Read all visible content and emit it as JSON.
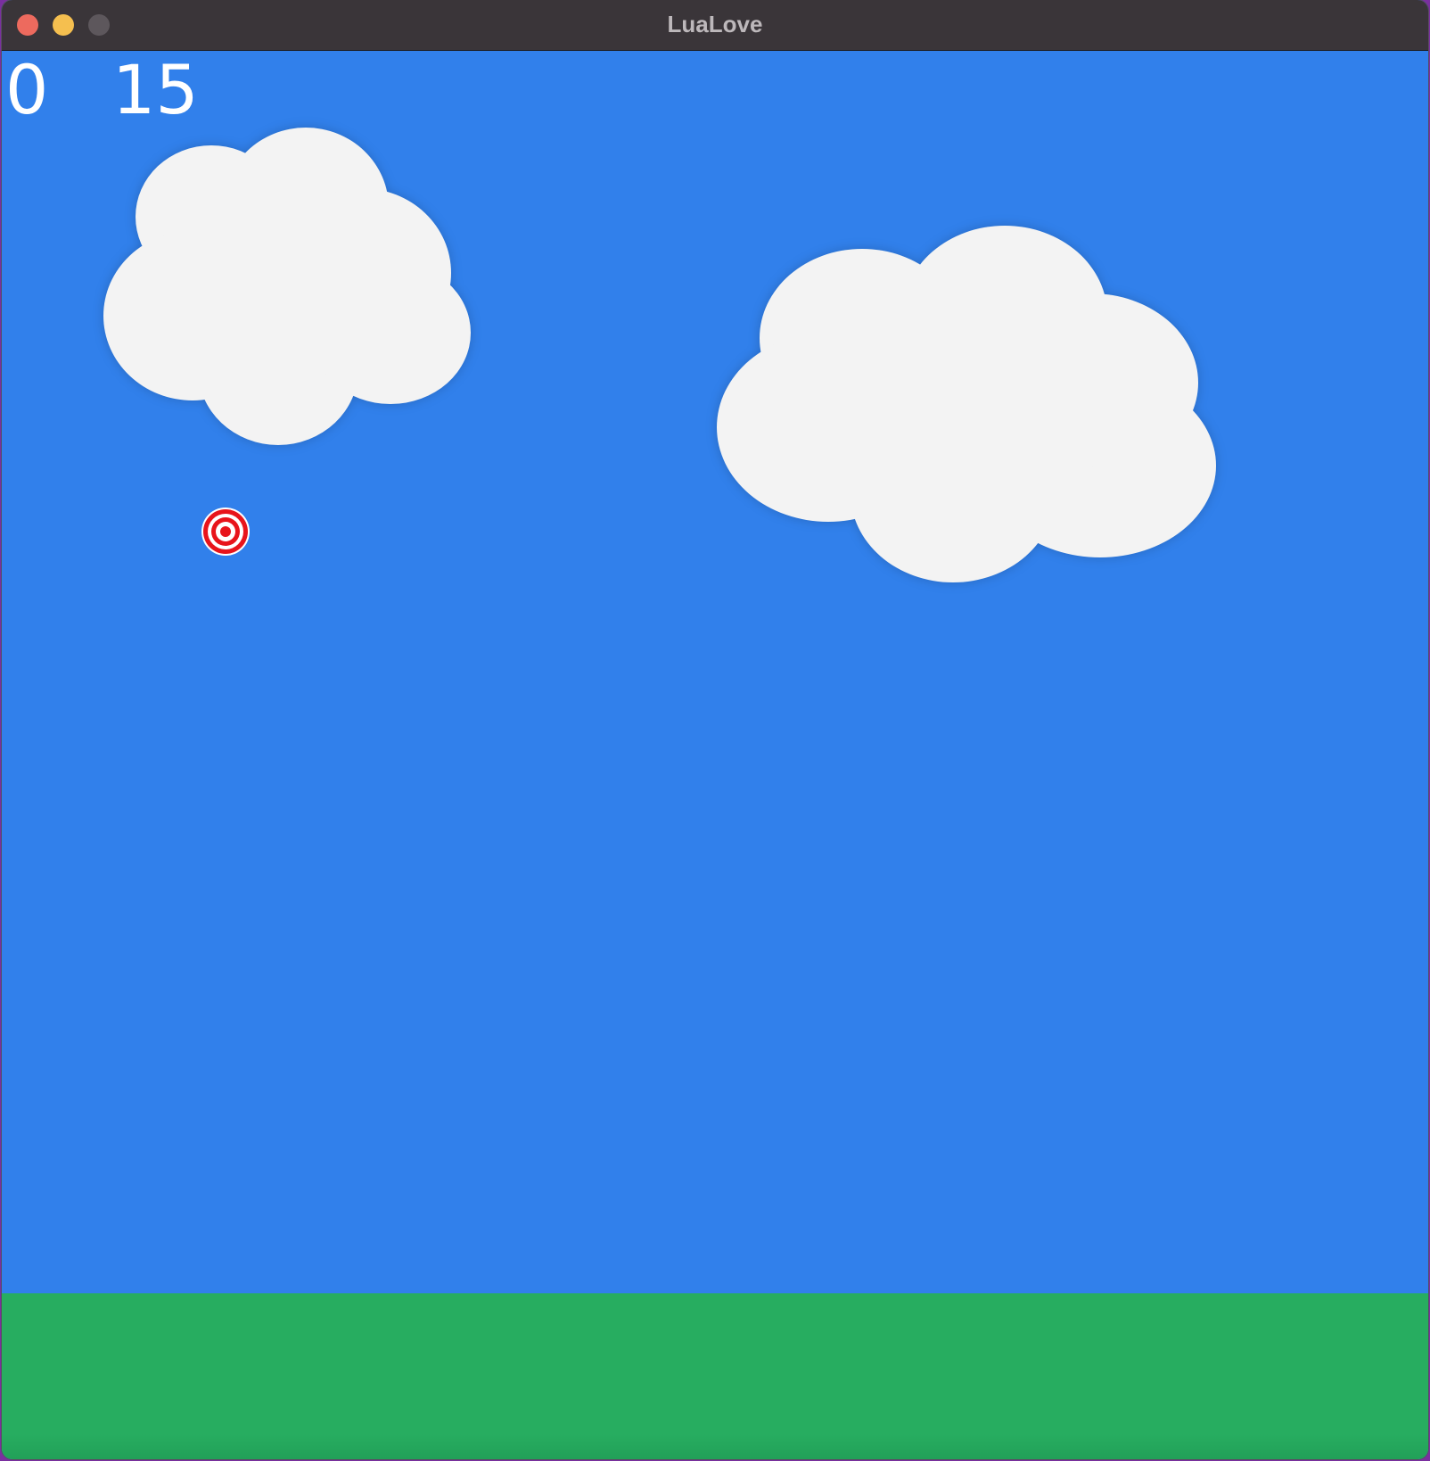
{
  "window": {
    "title": "LuaLove"
  },
  "hud": {
    "score": "0",
    "timer": "15"
  },
  "colors": {
    "sky": "#3180eb",
    "ground": "#27ad60",
    "cloud": "#f3f3f3",
    "target_red": "#e8141b",
    "titlebar": "#3a3539"
  },
  "icons": {
    "target": "bullseye-target-icon",
    "clouds": "cloud-icon"
  }
}
